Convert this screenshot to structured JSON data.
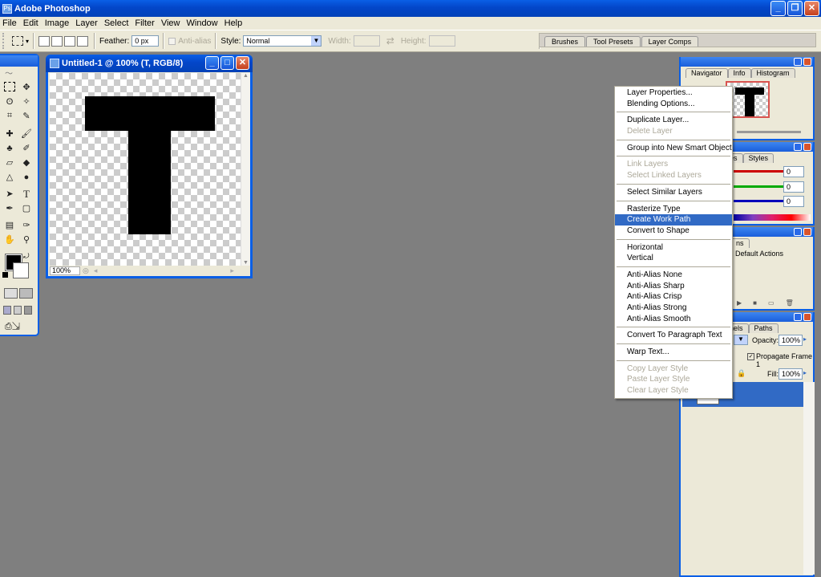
{
  "app": {
    "title": "Adobe Photoshop"
  },
  "menu": [
    "File",
    "Edit",
    "Image",
    "Layer",
    "Select",
    "Filter",
    "View",
    "Window",
    "Help"
  ],
  "options": {
    "feather_label": "Feather:",
    "feather_value": "0 px",
    "antialias_label": "Anti-alias",
    "style_label": "Style:",
    "style_value": "Normal",
    "width_label": "Width:",
    "height_label": "Height:"
  },
  "well_tabs": [
    "Brushes",
    "Tool Presets",
    "Layer Comps"
  ],
  "document": {
    "title": "Untitled-1 @ 100% (T, RGB/8)",
    "zoom": "100%",
    "canvas_letter": "T"
  },
  "navigator": {
    "tabs": [
      "Navigator",
      "Info",
      "Histogram"
    ]
  },
  "color_panel": {
    "tabs": [
      "Swatches",
      "Styles"
    ],
    "tabs_visible": [
      "es",
      "Styles"
    ],
    "r": "0",
    "g": "0",
    "b": "0"
  },
  "actions_panel": {
    "tab_fragment": "ns",
    "item": "Default Actions"
  },
  "layers_panel": {
    "tabs": [
      "nels",
      "Paths"
    ],
    "opacity_label": "Opacity:",
    "opacity_value": "100%",
    "propagate_label": "Propagate Frame 1",
    "fill_label": "Fill:",
    "fill_value": "100%"
  },
  "context_menu": {
    "groups": [
      [
        {
          "label": "Layer Properties...",
          "enabled": true
        },
        {
          "label": "Blending Options...",
          "enabled": true
        }
      ],
      [
        {
          "label": "Duplicate Layer...",
          "enabled": true
        },
        {
          "label": "Delete Layer",
          "enabled": false
        }
      ],
      [
        {
          "label": "Group into New Smart Object",
          "enabled": true
        }
      ],
      [
        {
          "label": "Link Layers",
          "enabled": false
        },
        {
          "label": "Select Linked Layers",
          "enabled": false
        }
      ],
      [
        {
          "label": "Select Similar Layers",
          "enabled": true
        }
      ],
      [
        {
          "label": "Rasterize Type",
          "enabled": true
        },
        {
          "label": "Create Work Path",
          "enabled": true,
          "selected": true
        },
        {
          "label": "Convert to Shape",
          "enabled": true
        }
      ],
      [
        {
          "label": "Horizontal",
          "enabled": true
        },
        {
          "label": "Vertical",
          "enabled": true
        }
      ],
      [
        {
          "label": "Anti-Alias None",
          "enabled": true
        },
        {
          "label": "Anti-Alias Sharp",
          "enabled": true
        },
        {
          "label": "Anti-Alias Crisp",
          "enabled": true
        },
        {
          "label": "Anti-Alias Strong",
          "enabled": true
        },
        {
          "label": "Anti-Alias Smooth",
          "enabled": true
        }
      ],
      [
        {
          "label": "Convert To Paragraph Text",
          "enabled": true
        }
      ],
      [
        {
          "label": "Warp Text...",
          "enabled": true
        }
      ],
      [
        {
          "label": "Copy Layer Style",
          "enabled": false
        },
        {
          "label": "Paste Layer Style",
          "enabled": false
        },
        {
          "label": "Clear Layer Style",
          "enabled": false
        }
      ]
    ]
  },
  "colors": {
    "xp_blue": "#0a5fe6",
    "workspace": "#7f7f7f",
    "menu_highlight": "#316ac5",
    "layer_highlight": "#316ac5"
  }
}
